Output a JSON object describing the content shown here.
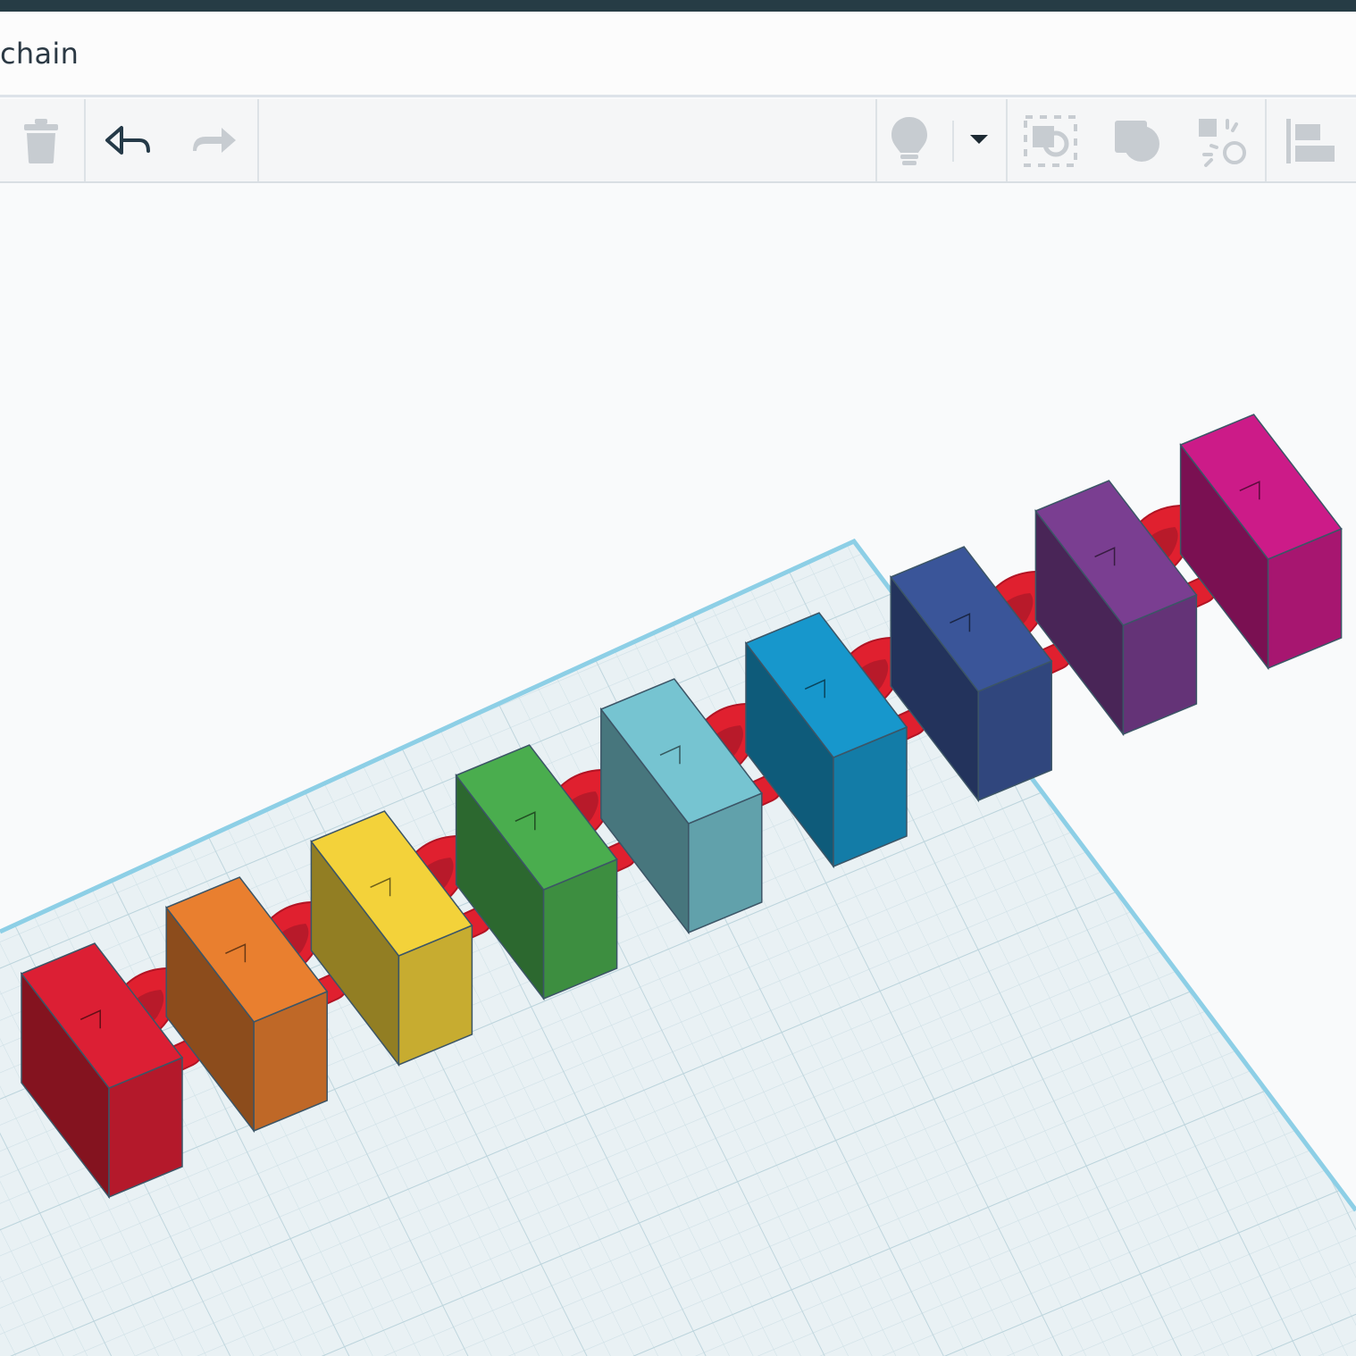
{
  "document": {
    "title": "chain"
  },
  "toolbar": {
    "buttons": [
      {
        "name": "delete-button",
        "icon": "trash-icon"
      },
      {
        "name": "undo-button",
        "icon": "undo-arrow-icon"
      },
      {
        "name": "redo-button",
        "icon": "redo-arrow-icon"
      },
      {
        "name": "notes-button",
        "icon": "lightbulb-icon"
      },
      {
        "name": "notes-dropdown-button",
        "icon": "caret-down-icon"
      },
      {
        "name": "group-button",
        "icon": "group-icon"
      },
      {
        "name": "ungroup-button",
        "icon": "ungroup-icon"
      },
      {
        "name": "mirror-button",
        "icon": "mirror-icon"
      },
      {
        "name": "align-button",
        "icon": "align-icon"
      }
    ]
  },
  "scene": {
    "links": [
      {
        "color": "#dc1f34"
      },
      {
        "color": "#e97f2f"
      },
      {
        "color": "#f3d23a"
      },
      {
        "color": "#4aad4e"
      },
      {
        "color": "#76c4d1"
      },
      {
        "color": "#1797cc"
      },
      {
        "color": "#3a5599"
      },
      {
        "color": "#7a3e91"
      },
      {
        "color": "#cc1b88"
      }
    ],
    "connector_color": "#e0202f",
    "workplane_color": "#e9f1f4",
    "workplane_edge_color": "#8dcfe6"
  }
}
